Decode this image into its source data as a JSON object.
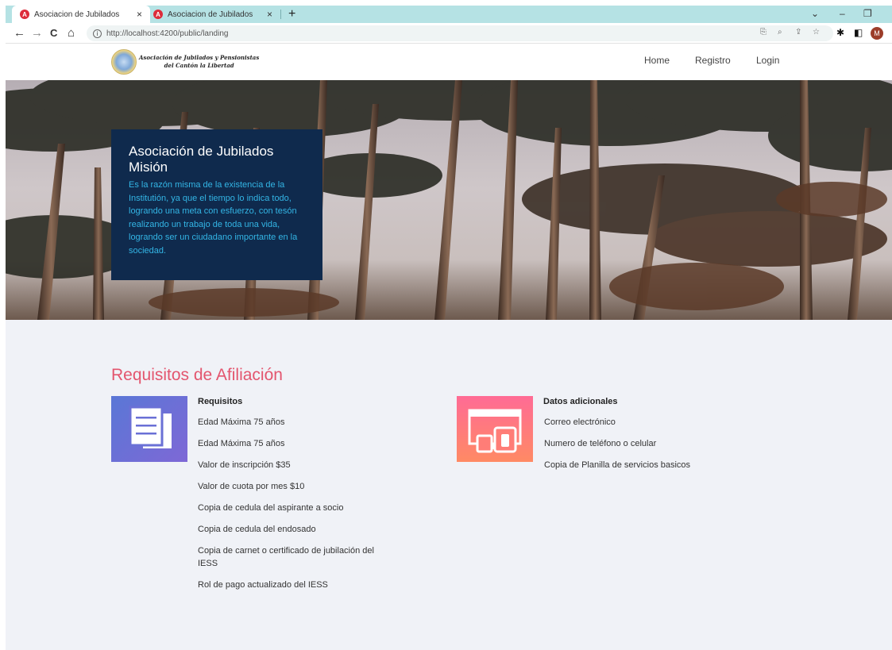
{
  "browser": {
    "tabs": [
      {
        "title": "Asociacion de Jubilados",
        "active": true
      },
      {
        "title": "Asociacion de Jubilados",
        "active": false
      }
    ],
    "favicon_letter": "A",
    "new_tab": "+",
    "url": "http://localhost:4200/public/landing",
    "profile_initial": "M",
    "icons": [
      "back-icon",
      "forward-icon",
      "reload-icon",
      "home-icon",
      "info-icon",
      "translate-icon",
      "zoom-icon",
      "share-icon",
      "star-icon",
      "extensions-icon",
      "sidepanel-icon"
    ],
    "glyphs": {
      "back": "←",
      "forward": "→",
      "reload": "C",
      "home": "⌂",
      "info": "i",
      "translate": "⎘",
      "zoom": "⌕",
      "share": "⇪",
      "star": "☆",
      "extensions": "✱",
      "sidepanel": "◧",
      "close": "×",
      "chevron": "⌄",
      "minimize": "–",
      "restore": "❐"
    }
  },
  "site": {
    "logo_line1": "Asociación de Jubilados y Pensionistas",
    "logo_line2": "del Cantón la Libertad",
    "nav": [
      "Home",
      "Registro",
      "Login"
    ]
  },
  "hero": {
    "title": "Asociación de Jubilados",
    "subtitle": "Misión",
    "text": "Es la razón misma de la existencia de la Institutión, ya que el tiempo lo indica todo, logrando una meta con esfuerzo, con tesón realizando un trabajo de toda una vida, logrando ser un ciudadano importante en la sociedad."
  },
  "requirements": {
    "heading": "Requisitos de Afiliación",
    "left": {
      "title": "Requisitos",
      "items": [
        "Edad Máxima 75 años",
        "Edad Máxima 75 años",
        "Valor de inscripción $35",
        "Valor de cuota por mes $10",
        "Copia de cedula del aspirante a socio",
        "Copia de cedula del endosado",
        "Copia de carnet o certificado de jubilación del IESS",
        "Rol de pago actualizado del IESS"
      ]
    },
    "right": {
      "title": "Datos adicionales",
      "items": [
        "Correo electrónico",
        "Numero de teléfono o celular",
        "Copia de Planilla de servicios basicos"
      ]
    }
  },
  "colors": {
    "tabstrip": "#b5e2e4",
    "mission_bg": "#0f2a4d",
    "mission_text": "#33b5e5",
    "heading": "#e3556e",
    "section_bg": "#f0f2f7"
  }
}
